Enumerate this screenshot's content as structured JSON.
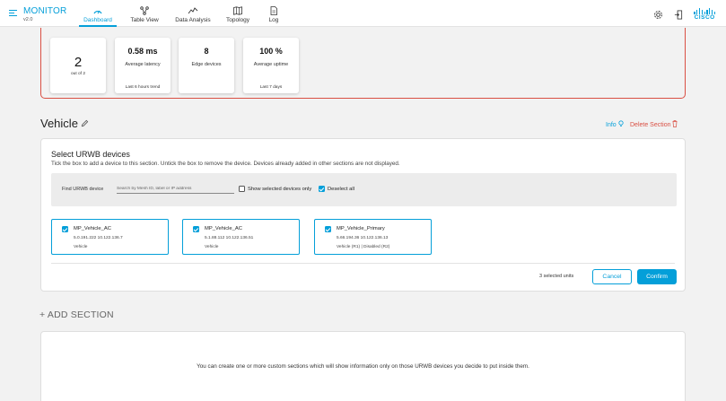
{
  "app": {
    "name": "MONITOR",
    "version": "v2.0"
  },
  "nav": [
    {
      "label": "Dashboard",
      "icon": "dashboard-gauge-icon",
      "active": true
    },
    {
      "label": "Table View",
      "icon": "table-view-icon"
    },
    {
      "label": "Data Analysis",
      "icon": "data-analysis-icon"
    },
    {
      "label": "Topology",
      "icon": "topology-map-icon"
    },
    {
      "label": "Log",
      "icon": "log-file-icon"
    }
  ],
  "header_icons": {
    "settings": "gear-icon",
    "logout": "logout-icon",
    "brand": "CISCO"
  },
  "stats": [
    {
      "value": "2",
      "label": "out of 2",
      "footer": ""
    },
    {
      "value": "0.58 ms",
      "label": "Average latency",
      "footer": "Last 6 hours trend"
    },
    {
      "value": "8",
      "label": "Edge devices",
      "footer": ""
    },
    {
      "value": "100 %",
      "label": "Average uptime",
      "footer": "Last 7 days"
    }
  ],
  "section": {
    "title": "Vehicle",
    "info_label": "Info",
    "delete_label": "Delete Section"
  },
  "urwb": {
    "title": "Select URWB devices",
    "description": "Tick the box to add a device to this section. Untick the box to remove the device. Devices already added in other sections are not displayed.",
    "find_label": "Find URWB device",
    "search_placeholder": "Search by Mesh ID, label or IP address",
    "show_selected_label": "Show selected devices only",
    "deselect_all_label": "Deselect all",
    "devices": [
      {
        "name": "MP_Vehicle_AC",
        "ip": "5.0.191.222  10.122.136.7",
        "type": "Vehicle",
        "checked": true
      },
      {
        "name": "MP_Vehicle_AC",
        "ip": "5.1.88.112  10.122.136.51",
        "type": "Vehicle",
        "checked": true
      },
      {
        "name": "MP_Vehicle_Primary",
        "ip": "5.66.194.36  10.122.136.13",
        "type": "Vehicle (R1) | Disabled (R2)",
        "checked": true
      }
    ],
    "selected_count": "3 selected units",
    "cancel_label": "Cancel",
    "confirm_label": "Confirm"
  },
  "add_section_label": "+ ADD SECTION",
  "empty_message": "You can create one or more custom sections which will show information only on those URWB devices you decide to put inside them.",
  "colors": {
    "accent": "#049fd9",
    "danger": "#d94f43"
  }
}
